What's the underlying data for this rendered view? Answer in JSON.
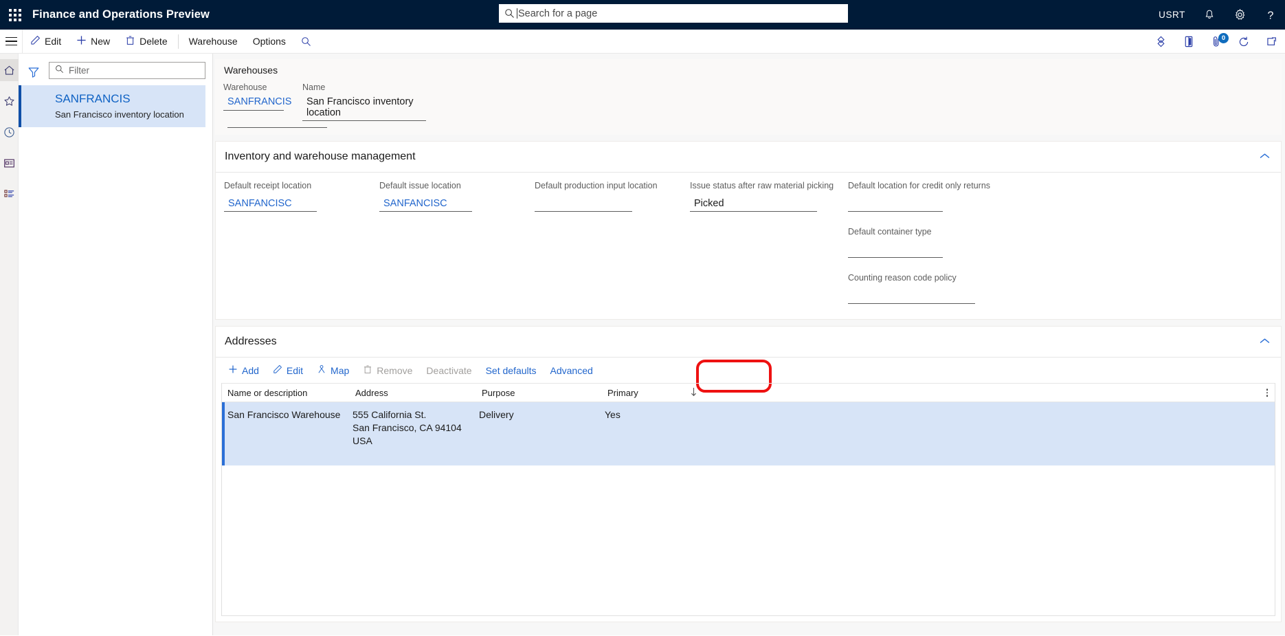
{
  "topbar": {
    "waffle_icon": "waffle-grid-icon",
    "app_title": "Finance and Operations Preview",
    "search_placeholder": "Search for a page",
    "search_value": "",
    "search_icon": "search-icon",
    "user_initials": "USRT",
    "notification_icon": "bell-icon",
    "settings_icon": "gear-icon",
    "help_icon": "question-mark-icon"
  },
  "action_pane": {
    "hamburger_icon": "hamburger-icon",
    "buttons": [
      {
        "label": "Edit",
        "icon": "pencil-icon"
      },
      {
        "label": "New",
        "icon": "plus-icon"
      },
      {
        "label": "Delete",
        "icon": "trash-icon"
      }
    ],
    "menus": [
      {
        "label": "Warehouse"
      },
      {
        "label": "Options"
      }
    ],
    "search_icon": "search-icon",
    "right_icons": [
      {
        "name": "share-diamond-icon"
      },
      {
        "name": "office-app-icon"
      },
      {
        "name": "attachment-icon",
        "badge": "0"
      },
      {
        "name": "refresh-icon"
      },
      {
        "name": "open-in-new-window-icon"
      }
    ]
  },
  "left_nav": {
    "items": [
      {
        "name": "home-icon",
        "label": "Home",
        "selected": true
      },
      {
        "name": "star-icon",
        "label": "Favorites",
        "selected": false
      },
      {
        "name": "clock-icon",
        "label": "Recent",
        "selected": false
      },
      {
        "name": "workspace-icon",
        "label": "Workspaces",
        "selected": false
      },
      {
        "name": "modules-list-icon",
        "label": "Modules",
        "selected": false
      }
    ]
  },
  "list_panel": {
    "rail": [
      {
        "name": "filter-funnel-icon",
        "selected": false
      },
      {
        "name": "list-lines-icon",
        "selected": true
      }
    ],
    "filter_placeholder": "Filter",
    "filter_value": "",
    "items": [
      {
        "title": "SANFRANCIS",
        "subtitle": "San Francisco inventory location",
        "selected": true
      }
    ]
  },
  "header_card": {
    "title": "Warehouses",
    "fields": [
      {
        "label": "Warehouse",
        "value": "SANFRANCIS",
        "link": true
      },
      {
        "label": "Name",
        "value": "San Francisco inventory location",
        "link": false
      }
    ]
  },
  "inventory_section": {
    "title": "Inventory and warehouse management",
    "collapse_icon": "chevron-up-icon",
    "columns": [
      {
        "fields": [
          {
            "label": "Default receipt location",
            "value": "SANFANCISC",
            "link": true
          }
        ]
      },
      {
        "fields": [
          {
            "label": "Default issue location",
            "value": "SANFANCISC",
            "link": true
          }
        ]
      },
      {
        "fields": [
          {
            "label": "Default production input location",
            "value": "",
            "link": false
          }
        ]
      },
      {
        "fields": [
          {
            "label": "Issue status after raw material picking",
            "value": "Picked",
            "link": false
          }
        ]
      },
      {
        "fields": [
          {
            "label": "Default location for credit only returns",
            "value": "",
            "link": false
          },
          {
            "label": "Default container type",
            "value": "",
            "link": false
          },
          {
            "label": "Counting reason code policy",
            "value": "",
            "link": false
          }
        ]
      }
    ]
  },
  "addresses_section": {
    "title": "Addresses",
    "collapse_icon": "chevron-up-icon",
    "toolbar": [
      {
        "label": "Add",
        "icon": "plus-icon",
        "disabled": false
      },
      {
        "label": "Edit",
        "icon": "pencil-icon",
        "disabled": false
      },
      {
        "label": "Map",
        "icon": "map-pin-person-icon",
        "disabled": false
      },
      {
        "label": "Remove",
        "icon": "trash-icon",
        "disabled": true
      },
      {
        "label": "Deactivate",
        "icon": "",
        "disabled": true
      },
      {
        "label": "Set defaults",
        "icon": "",
        "disabled": false
      },
      {
        "label": "Advanced",
        "icon": "",
        "disabled": false,
        "highlighted": true
      }
    ],
    "grid": {
      "columns": [
        {
          "label": "Name or description",
          "sorted": false
        },
        {
          "label": "Address",
          "sorted": false
        },
        {
          "label": "Purpose",
          "sorted": false
        },
        {
          "label": "Primary",
          "sorted": true,
          "sort_icon": "sort-descending-arrow"
        }
      ],
      "options_icon": "grid-options-icon",
      "rows": [
        {
          "name": "San Francisco Warehouse",
          "address": "555 California St.\nSan Francisco, CA 94104\nUSA",
          "purpose": "Delivery",
          "primary": "Yes",
          "selected": true
        }
      ]
    }
  },
  "colors": {
    "header_bg": "#001b38",
    "accent_link": "#2266cc",
    "selection_bg": "#d7e4f7",
    "selection_bar": "#2b6fd6",
    "highlight_box": "#ee1111",
    "badge_bg": "#0f6cbd"
  }
}
